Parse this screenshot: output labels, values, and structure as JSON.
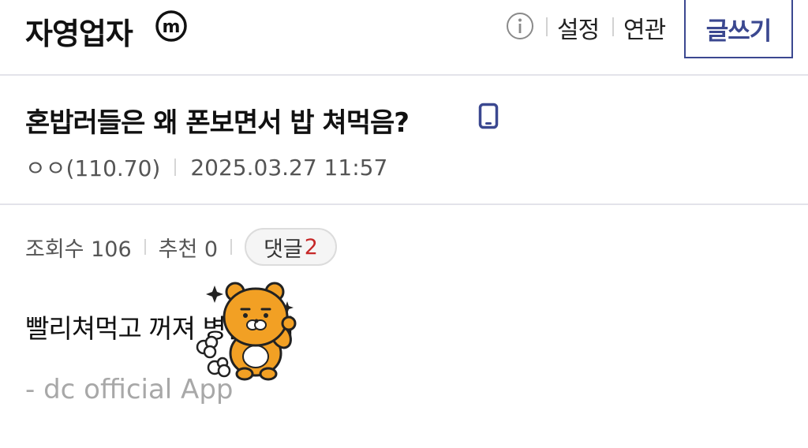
{
  "header": {
    "gallery_title": "자영업자",
    "minor_badge": "m",
    "info_icon": "info-icon",
    "settings_label": "설정",
    "related_label": "연관",
    "write_label": "글쓰기",
    "accent_color": "#3b4890"
  },
  "post": {
    "title": "혼밥러들은 왜 폰보면서 밥 쳐먹음?",
    "device_icon": "mobile-phone-icon",
    "author": "ㅇㅇ(110.70)",
    "datetime": "2025.03.27 11:57"
  },
  "stats": {
    "views_label": "조회수 106",
    "recommend_label": "추천 0",
    "comments_label": "댓글",
    "comments_count": "2",
    "count_color": "#c62828"
  },
  "body": {
    "text": "빨리쳐먹고 꺼져 병신들아",
    "signature": "- dc official App",
    "sticker": "ryan-sticker"
  }
}
